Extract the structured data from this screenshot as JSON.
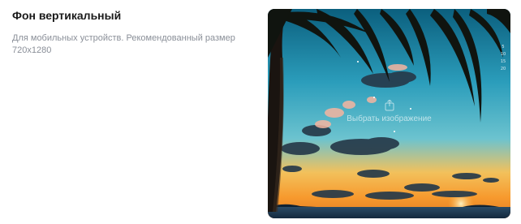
{
  "section": {
    "title": "Фон вертикальный",
    "description_line1": "Для мобильных устройств. Рекомендованный размер",
    "description_line2": "720x1280"
  },
  "preview": {
    "overlay_label": "Выбрать изображение",
    "upload_icon": "upload-icon",
    "side_numbers": [
      "5",
      "",
      "10",
      "15",
      "20"
    ]
  },
  "colors": {
    "sky_top": "#0e6c8c",
    "sky_mid": "#36a9c4",
    "sunset": "#f7a93a",
    "sea": "#1d3a55"
  }
}
